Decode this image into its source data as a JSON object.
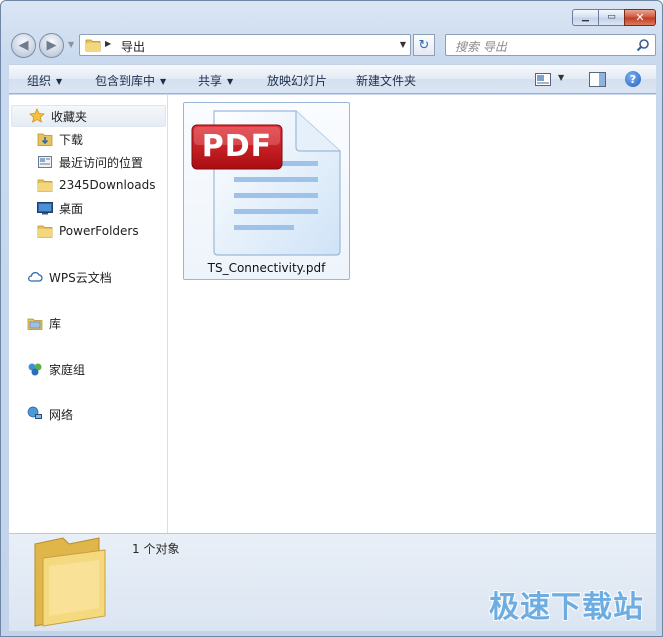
{
  "window": {
    "caption_minimize": "▁",
    "caption_maximize": "▭",
    "caption_close": "✕"
  },
  "nav": {
    "back_icon": "◀",
    "forward_icon": "▶",
    "address_path": "导出",
    "search_placeholder": "搜索 导出",
    "refresh_icon": "↻"
  },
  "toolbar": {
    "organize": "组织",
    "include_in_library": "包含到库中",
    "share": "共享",
    "slideshow": "放映幻灯片",
    "new_folder": "新建文件夹",
    "help": "?"
  },
  "sidebar": {
    "favorites": "收藏夹",
    "favorites_items": [
      {
        "label": "下载",
        "icon": "download-folder-icon"
      },
      {
        "label": "最近访问的位置",
        "icon": "recent-places-icon"
      },
      {
        "label": "2345Downloads",
        "icon": "folder-icon"
      },
      {
        "label": "桌面",
        "icon": "desktop-icon"
      },
      {
        "label": "PowerFolders",
        "icon": "folder-icon"
      }
    ],
    "wps_cloud": "WPS云文档",
    "libraries": "库",
    "homegroup": "家庭组",
    "network": "网络"
  },
  "files": [
    {
      "name": "TS_Connectivity.pdf",
      "badge": "PDF",
      "icon": "pdf-file-icon"
    }
  ],
  "details": {
    "item_count": "1 个对象"
  },
  "watermark": "极速下载站",
  "colors": {
    "pdf_red": "#c8141a",
    "accent_blue": "#2f6ab3",
    "folder_yellow": "#e8c25a"
  }
}
